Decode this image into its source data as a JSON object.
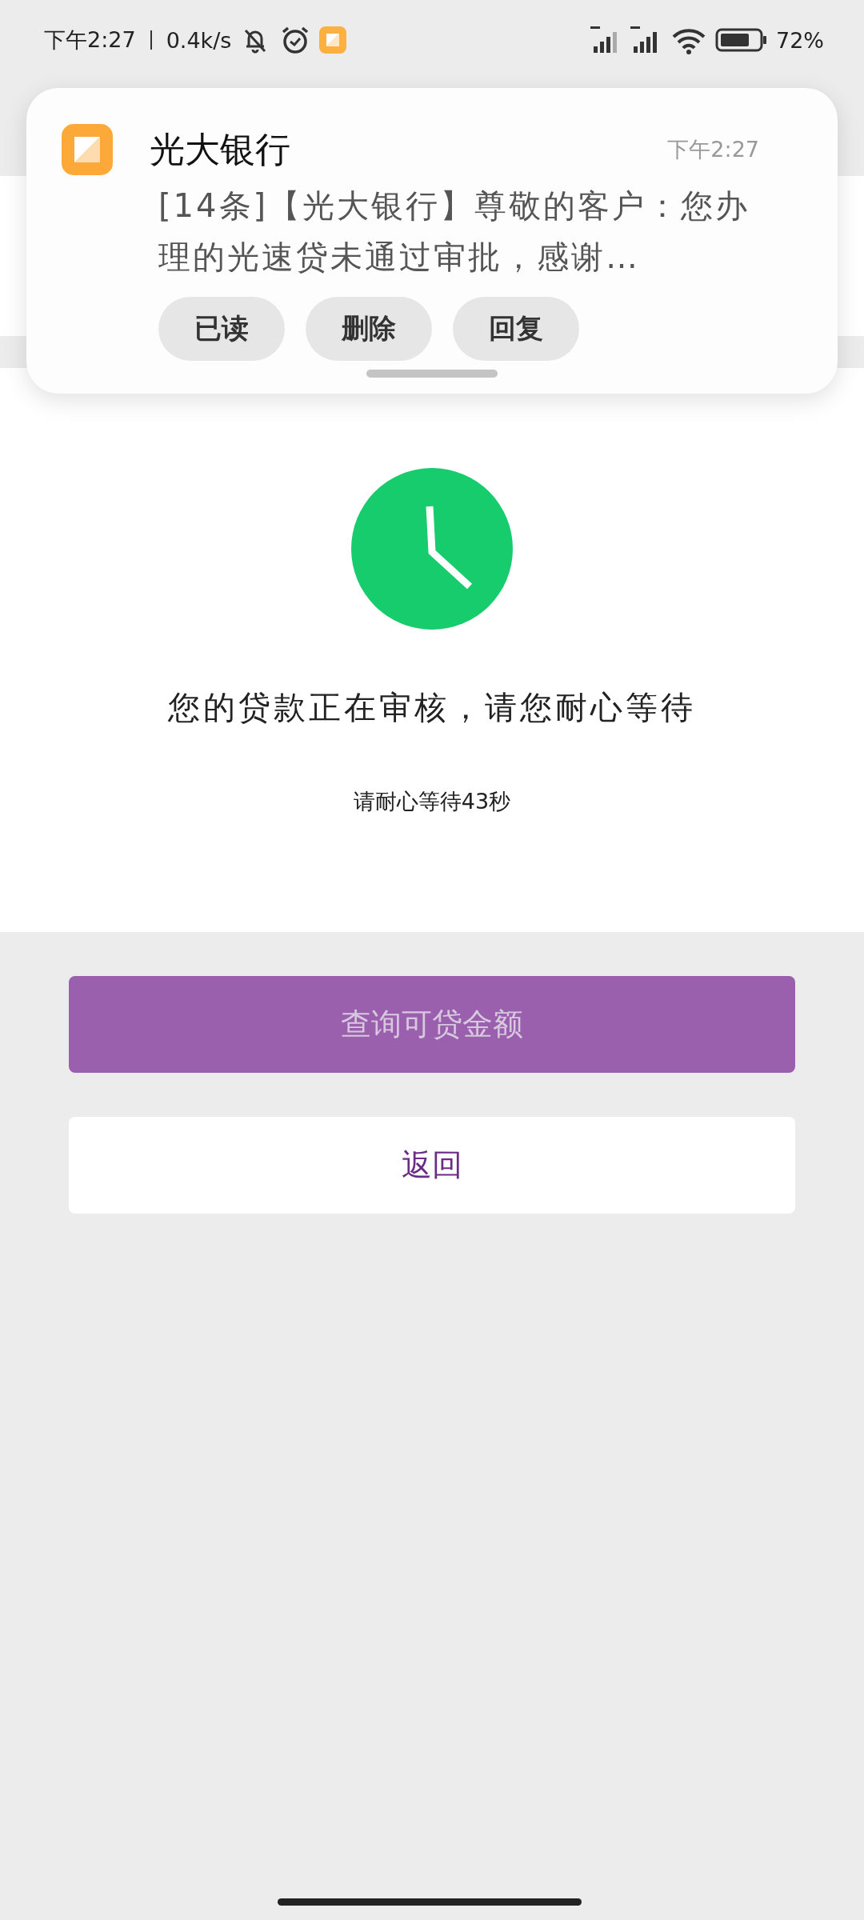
{
  "status_bar": {
    "time": "下午2:27",
    "speed": "0.4k/s",
    "battery": "72%"
  },
  "page": {
    "message": "您的贷款正在审核，请您耐心等待",
    "countdown": "请耐心等待43秒",
    "buttons": [
      {
        "label": "查询可贷金额",
        "kind": "primary"
      },
      {
        "label": "返回",
        "kind": "secondary"
      }
    ]
  },
  "notification": {
    "app": "光大银行",
    "time": "下午2:27",
    "message": "[14条]【光大银行】尊敬的客户：您办理的光速贷未通过审批，感谢…",
    "actions": [
      "已读",
      "删除",
      "回复"
    ]
  }
}
